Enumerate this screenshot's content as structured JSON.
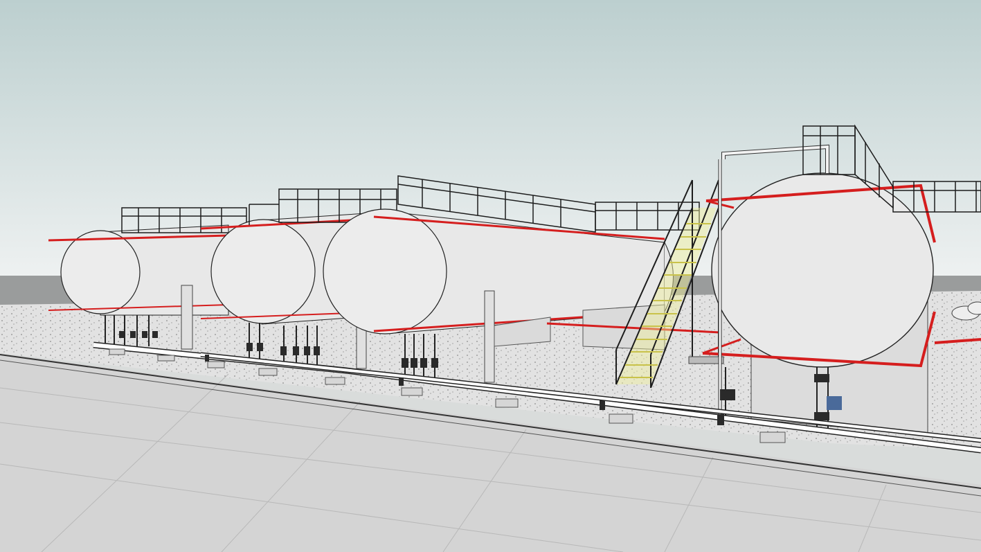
{
  "scene": {
    "tank_count": 4,
    "colors": {
      "sky_top": "#bccfcf",
      "sky_horizon": "#eef1f1",
      "distant_ground": "#9a9c9c",
      "gravel": "#e2e2e2",
      "paving": "#d4d4d4",
      "tank_fill": "#e8e8e8",
      "fire_line_red": "#d51e1e",
      "steel_dark": "#1c1c1c",
      "stair_tread": "#e6e27a",
      "concrete": "#dcdcdc",
      "valve_blue": "#4a6a9a"
    }
  }
}
